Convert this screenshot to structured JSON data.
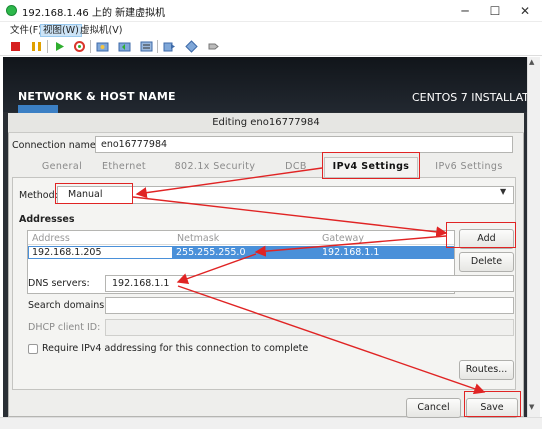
{
  "window": {
    "title": "192.168.1.46 上的 新建虚拟机",
    "minimize": "─",
    "maximize": "☐",
    "close": "✕"
  },
  "menubar": {
    "items": [
      "文件(F)",
      "视图(W)",
      "虚拟机(V)"
    ]
  },
  "toolbar": {
    "icons": [
      "stop-icon",
      "pause-icon",
      "play-icon",
      "refresh-icon",
      "snapshot-icon",
      "snapshot-revert-icon",
      "snapshot-manager-icon",
      "send-keys-icon",
      "settings-icon",
      "connect-icon"
    ]
  },
  "vm": {
    "header_left": "NETWORK & HOST NAME",
    "header_right": "CENTOS 7 INSTALLATIO",
    "blue_bar_color": "#3b7fc4"
  },
  "dialog": {
    "title": "Editing eno16777984",
    "connection_name_label": "Connection name:",
    "connection_name_value": "eno16777984",
    "tabs": [
      "General",
      "Ethernet",
      "802.1x Security",
      "DCB",
      "IPv4 Settings",
      "IPv6 Settings"
    ],
    "active_tab": "IPv4 Settings",
    "method_label": "Method:",
    "method_value": "Manual",
    "addresses_heading": "Addresses",
    "address_columns": [
      "Address",
      "Netmask",
      "Gateway"
    ],
    "address_rows": [
      {
        "address": "192.168.1.205",
        "netmask": "255.255.255.0",
        "gateway": "192.168.1.1"
      }
    ],
    "add_button": "Add",
    "delete_button": "Delete",
    "dns_label": "DNS servers:",
    "dns_value": "192.168.1.1",
    "search_label": "Search domains:",
    "search_value": "",
    "dhcp_label": "DHCP client ID:",
    "dhcp_value": "",
    "require_ipv4_label": "Require IPv4 addressing for this connection to complete",
    "require_ipv4_checked": false,
    "routes_button": "Routes...",
    "cancel_button": "Cancel",
    "save_button": "Save"
  },
  "annotation_color": "#e02424"
}
